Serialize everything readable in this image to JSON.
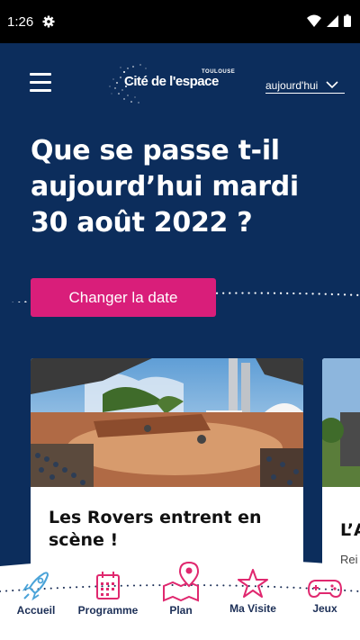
{
  "status_bar": {
    "time": "1:26"
  },
  "header": {
    "logo_city": "TOULOUSE",
    "logo_text": "Cité de l'espace",
    "date_select_value": "aujourd'hui"
  },
  "headline": "Que se passe t-il aujourd’hui mardi 30 août 2022 ?",
  "change_date_button": "Changer la date",
  "cards": [
    {
      "title": "Les Rovers entrent en scène !"
    },
    {
      "title": "L’A",
      "subtitle": "Rei"
    }
  ],
  "bottom_nav": [
    {
      "label": "Accueil",
      "icon": "rocket-icon"
    },
    {
      "label": "Programme",
      "icon": "calendar-icon"
    },
    {
      "label": "Plan",
      "icon": "map-pin-icon"
    },
    {
      "label": "Ma Visite",
      "icon": "star-icon"
    },
    {
      "label": "Jeux",
      "icon": "gamepad-icon"
    }
  ],
  "colors": {
    "background": "#0c2d5c",
    "accent": "#d91e7a",
    "nav_label": "#1b2e56",
    "icon_accent": "#e0286f"
  }
}
